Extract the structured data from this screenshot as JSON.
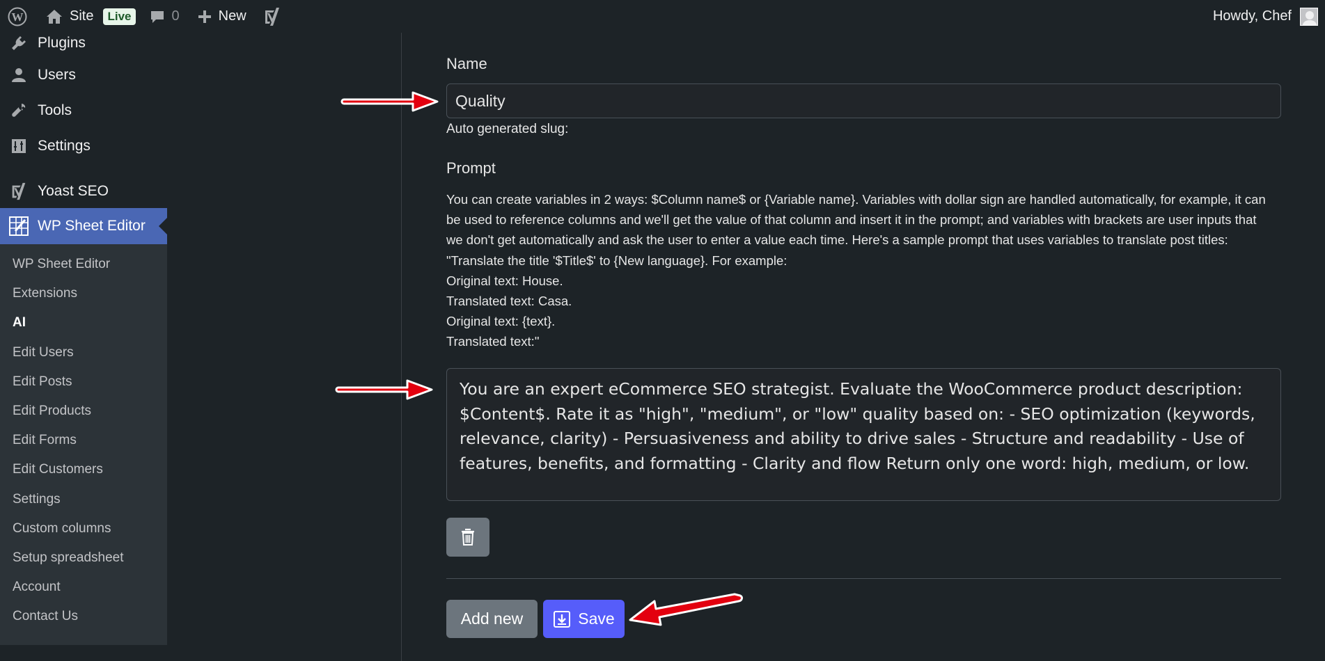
{
  "adminbar": {
    "site_label": "Site",
    "live_badge": "Live",
    "comment_count": "0",
    "new_label": "New",
    "howdy": "Howdy, Chef"
  },
  "sidebar": {
    "top_items": [
      {
        "label": "Plugins",
        "icon": "plugin-icon"
      },
      {
        "label": "Users",
        "icon": "user-icon"
      },
      {
        "label": "Tools",
        "icon": "wrench-icon"
      },
      {
        "label": "Settings",
        "icon": "settings-icon"
      },
      {
        "label": "Yoast SEO",
        "icon": "yoast-icon"
      },
      {
        "label": "WP Sheet Editor",
        "icon": "spreadsheet-icon"
      }
    ],
    "sub_items": [
      "WP Sheet Editor",
      "Extensions",
      "AI",
      "Edit Users",
      "Edit Posts",
      "Edit Products",
      "Edit Forms",
      "Edit Customers",
      "Settings",
      "Custom columns",
      "Setup spreadsheet",
      "Account",
      "Contact Us"
    ],
    "current_sub": "AI"
  },
  "form": {
    "name_label": "Name",
    "name_value": "Quality",
    "slug_text": "Auto generated slug:",
    "prompt_label": "Prompt",
    "help_lines": [
      "You can create variables in 2 ways: $Column name$ or {Variable name}. Variables with dollar sign are handled automatically, for example, it can be used to reference columns and we'll get the value of that column and insert it in the prompt; and variables with brackets are user inputs that we don't get automatically and ask the user to enter a value each time. Here's a sample prompt that uses variables to translate post titles: \"Translate the title '$Title$' to {New language}. For example:",
      "Original text: House.",
      "Translated text: Casa.",
      "Original text: {text}.",
      "Translated text:\""
    ],
    "prompt_value": "You are an expert eCommerce SEO strategist. Evaluate the WooCommerce product description: $Content$. Rate it as \"high\", \"medium\", or \"low\" quality based on: - SEO optimization (keywords, relevance, clarity) - Persuasiveness and ability to drive sales - Structure and readability - Use of features, benefits, and formatting - Clarity and flow Return only one word: high, medium, or low.",
    "add_new_label": "Add new",
    "save_label": "Save"
  },
  "colors": {
    "accent": "#565dfa",
    "admin_active": "#4a67b4",
    "arrow": "#e3000f"
  }
}
